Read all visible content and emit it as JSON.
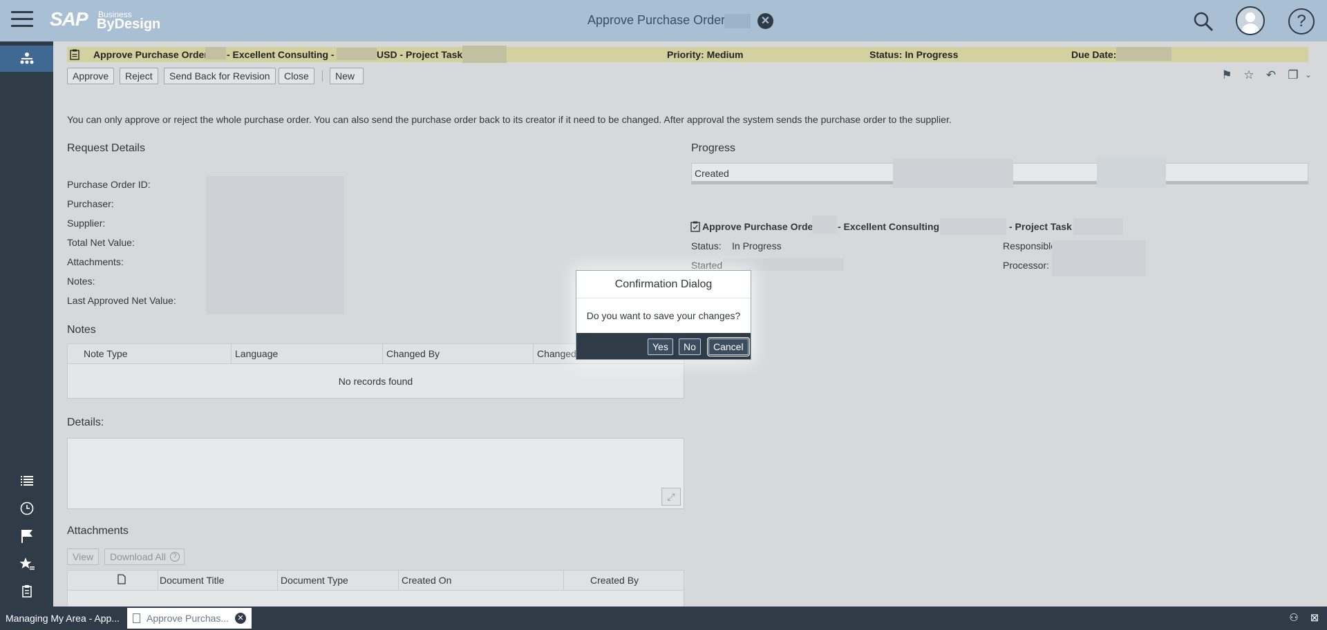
{
  "shell": {
    "menu_icon": "hamburger-menu-icon",
    "logo_main": "SAP",
    "logo_small": "Business",
    "logo_product": "ByDesign",
    "title": "Approve Purchase Order:",
    "close_glyph": "✕",
    "help_glyph": "?"
  },
  "object_header": {
    "part1": "Approve Purchase Order",
    "part2": "- Excellent Consulting -",
    "part3": "USD - Project Task",
    "priority": "Priority: Medium",
    "status": "Status: In Progress",
    "due": "Due Date:"
  },
  "toolbar": {
    "approve": "Approve",
    "reject": "Reject",
    "send_back": "Send Back for Revision",
    "close": "Close",
    "new": "New"
  },
  "info_text": "You can only approve or reject the whole purchase order. You can also send the purchase order back to its creator if it need to be changed. After approval the system sends the purchase order to the supplier.",
  "request_details": {
    "title": "Request Details",
    "fields": [
      "Purchase Order ID:",
      "Purchaser:",
      "Supplier:",
      "Total Net Value:",
      "Attachments:",
      "Notes:",
      "Last Approved Net Value:"
    ]
  },
  "progress": {
    "title": "Progress",
    "stage": "Created"
  },
  "task": {
    "title_a": "Approve Purchase Order",
    "title_b": "- Excellent Consulting",
    "title_c": "- Project Task",
    "status_label": "Status:",
    "status_value": "In Progress",
    "started_label": "Started:",
    "responsible_label": "Responsible",
    "processor_label": "Processor:"
  },
  "notes": {
    "title": "Notes",
    "columns": [
      "Note Type",
      "Language",
      "Changed By",
      "Changed"
    ],
    "empty": "No records found"
  },
  "details": {
    "title": "Details:"
  },
  "attachments": {
    "title": "Attachments",
    "view": "View",
    "download_all": "Download All",
    "columns": [
      "Document Title",
      "Document Type",
      "Created On",
      "Created By"
    ]
  },
  "dialog": {
    "title": "Confirmation Dialog",
    "message": "Do you want to save your changes?",
    "yes": "Yes",
    "no": "No",
    "cancel": "Cancel"
  },
  "taskbar": {
    "tab1": "Managing My Area - App...",
    "tab2": "Approve Purchas..."
  },
  "colors": {
    "shell": "#a9bfd3",
    "sidebar": "#2f3c48",
    "object_bar": "#d4d1a0",
    "sidebar_active": "#3f6992"
  }
}
